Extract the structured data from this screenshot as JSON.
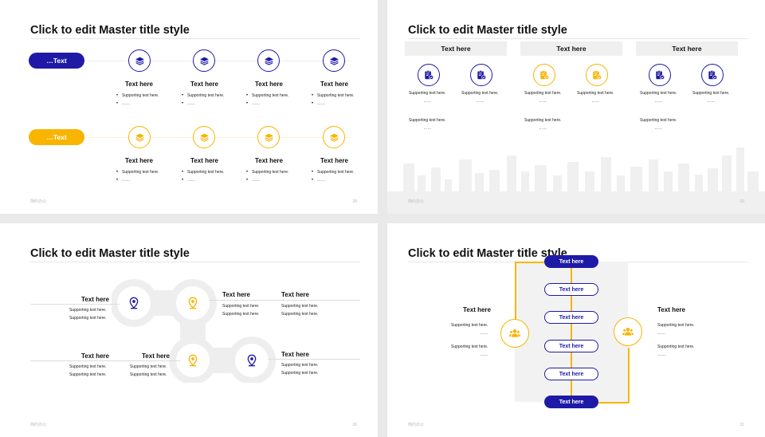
{
  "colors": {
    "blue": "#1f1aa6",
    "yellow": "#f7b500"
  },
  "slide1": {
    "title": "Click to edit Master title style",
    "row1_pill": "…Text",
    "row2_pill": "…Text",
    "heading": "Text here",
    "support": "Supporting text here.",
    "dots": "……",
    "brand": "简约办公",
    "page": "28"
  },
  "slide2": {
    "title": "Click to edit Master title style",
    "columns": [
      "Text here",
      "Text here",
      "Text here"
    ],
    "support": "Supporting text here.",
    "dots": "……",
    "brand": "简约办公",
    "page": "29"
  },
  "slide3": {
    "title": "Click to edit Master title style",
    "heading": "Text here",
    "support": "Supporting text here.",
    "brand": "简约办公",
    "page": "30"
  },
  "slide4": {
    "title": "Click to edit Master title style",
    "flow": [
      "Text here",
      "Text here",
      "Text here",
      "Text here",
      "Text here",
      "Text here"
    ],
    "left_heading": "Text here",
    "right_heading": "Text here",
    "support": "Supporting text here.",
    "dots": "……",
    "brand": "简约办公",
    "page": "31"
  }
}
